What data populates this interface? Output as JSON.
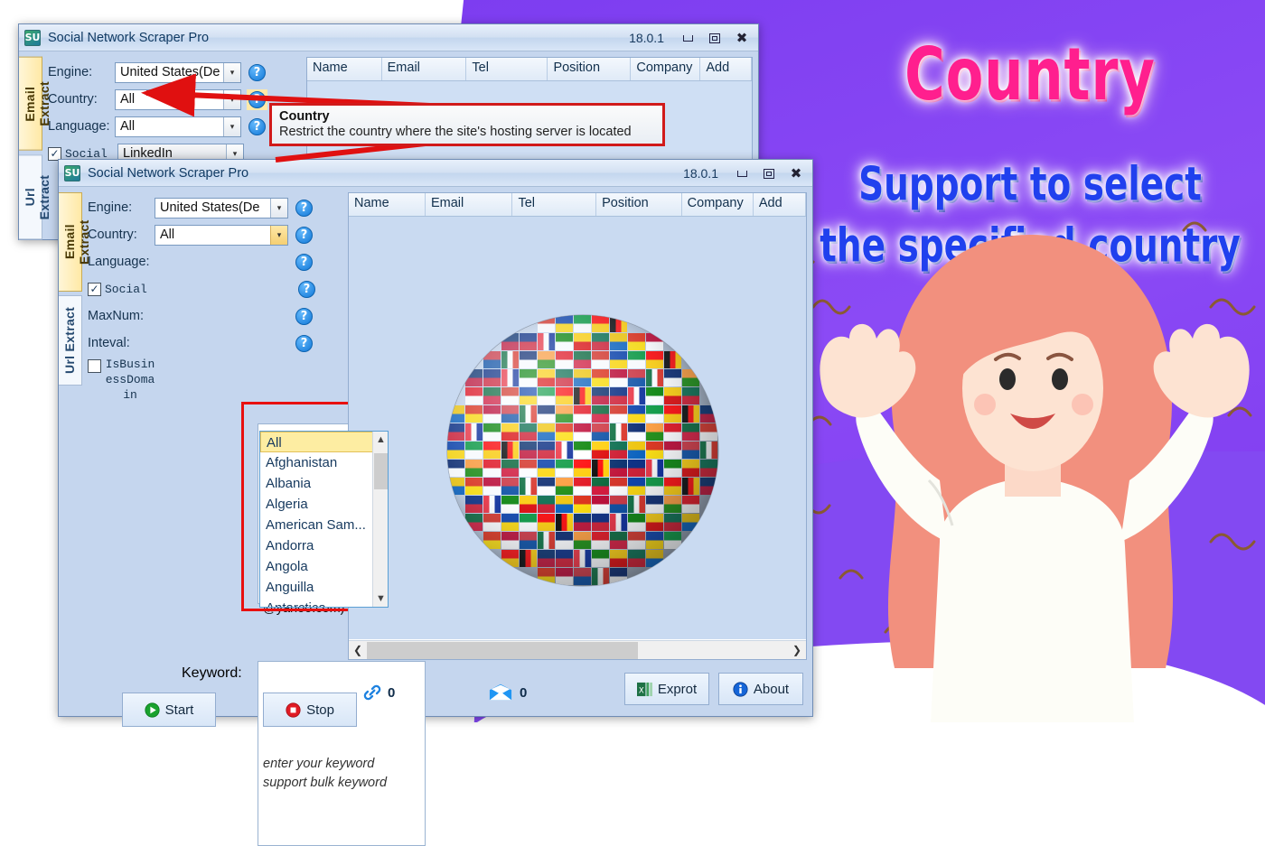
{
  "app": {
    "title": "Social Network Scraper Pro",
    "version": "18.0.1",
    "icon": "app-logo-icon"
  },
  "titlebar_buttons": {
    "minimize": "minimize-icon",
    "maximize": "maximize-icon",
    "close": "close-icon"
  },
  "vertical_tabs": [
    {
      "label": "Email Extract",
      "active": true
    },
    {
      "label": "Url Extract",
      "active": false
    }
  ],
  "form": {
    "engine": {
      "label": "Engine:",
      "value": "United States(De"
    },
    "country": {
      "label": "Country:",
      "value": "All"
    },
    "language": {
      "label": "Language:",
      "value": "All"
    },
    "social": {
      "label": "Social",
      "value": "LinkedIn",
      "checked": true
    },
    "maxnum": {
      "label": "MaxNum:",
      "value": ""
    },
    "inteval": {
      "label": "Inteval:",
      "value": ""
    },
    "isbusinessdomain": {
      "label": "IsBusinessDomain",
      "checked": false
    },
    "email_filter": {
      "value": "(@gmail.com OR\n@yahoo.com)"
    },
    "keyword": {
      "label": "Keyword:",
      "value": "",
      "placeholder_line1": "enter your keyword",
      "placeholder_line2": "support bulk keyword"
    },
    "help_icon": "?"
  },
  "country_dropdown": {
    "selected": "All",
    "items": [
      "All",
      "Afghanistan",
      "Albania",
      "Algeria",
      "American Sam...",
      "Andorra",
      "Angola",
      "Anguilla",
      "Antarctica"
    ],
    "scroll_up_icon": "chevron-up-icon",
    "scroll_down_icon": "chevron-down-icon"
  },
  "tooltip": {
    "title": "Country",
    "body": "Restrict the country where the site's hosting server is located"
  },
  "table": {
    "columns": [
      "Name",
      "Email",
      "Tel",
      "Position",
      "Company",
      "Add"
    ]
  },
  "actions": {
    "start": {
      "label": "Start",
      "icon": "play-icon"
    },
    "stop": {
      "label": "Stop",
      "icon": "stop-icon"
    },
    "export": {
      "label": "Exprot",
      "icon": "excel-icon"
    },
    "about": {
      "label": "About",
      "icon": "info-icon"
    }
  },
  "status": {
    "link_icon": "link-icon",
    "link_count": "0",
    "mail_icon": "mail-icon",
    "mail_count": "0"
  },
  "scrollbar": {
    "left_arrow": "chevron-left-icon",
    "right_arrow": "chevron-right-icon"
  },
  "promo": {
    "title": "Country",
    "line1": "Support to select",
    "line2": "the specified country",
    "title_color": "#ff1f8e",
    "line_color": "#2040ee",
    "background_color": "#7c3cf0"
  }
}
